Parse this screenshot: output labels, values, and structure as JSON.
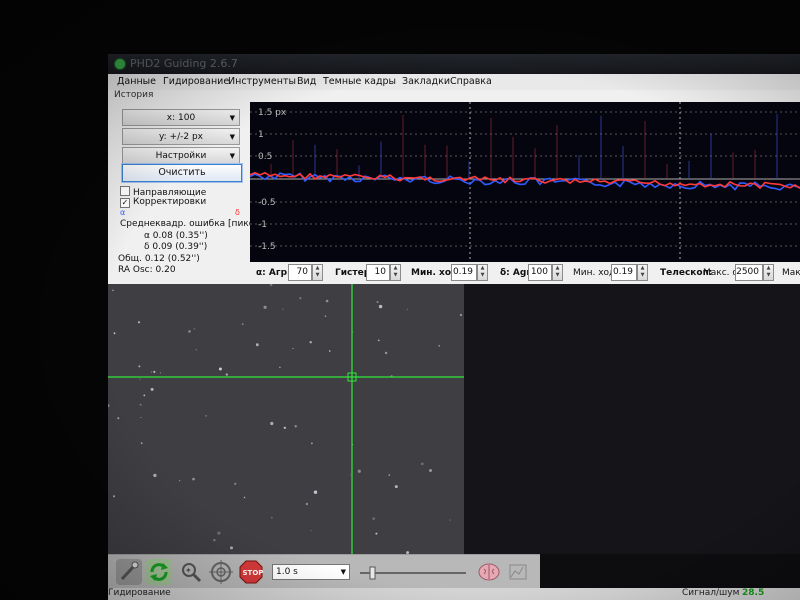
{
  "window": {
    "title": "PHD2 Guiding 2.6.7"
  },
  "menu": [
    "Данные",
    "Гидирование",
    "Инструменты",
    "Вид",
    "Темные кадры",
    "Закладки",
    "Справка"
  ],
  "history": {
    "label": "История",
    "x_scale": "x: 100",
    "y_scale": "y: +/-2 px",
    "settings": "Настройки",
    "clear": "Очистить",
    "cb_guides": "Направляющие",
    "cb_corrections": "Корректировки",
    "ra_symbol": "α",
    "dec_symbol": "δ",
    "rms_title": "Среднеквадр. ошибка [пикс.]",
    "rms_ra": "α 0.08 (0.35'')",
    "rms_dec": "δ 0.09 (0.39'')",
    "rms_total": "Общ. 0.12 (0.52'')",
    "ra_osc": "RA Osc: 0.20",
    "ytick_labels": [
      "1.5 px",
      "1",
      "0.5",
      "-0.5",
      "-1",
      "-1.5"
    ]
  },
  "params": {
    "ra_aggr_label": "α: Агр.",
    "ra_aggr": "70",
    "hyst_label": "Гистер.",
    "hyst": "10",
    "minmove_label": "Мин. ход",
    "ra_minmove": "0.19",
    "dec_aggr_label": "δ: Agr",
    "dec_aggr": "100",
    "dec_minmove_label": "Мин. ход",
    "dec_minmove": "0.19",
    "scope_label": "Телескоп:",
    "max_ra_label": "Макс. α",
    "max_ra": "2500",
    "max_dec_label": "Макс"
  },
  "toolbar": {
    "exposure": "1.0 s"
  },
  "status": {
    "mode": "Гидирование",
    "snr_label": "Сигнал/шум",
    "snr": "28.5"
  },
  "colors": {
    "ra": "#ff3a3a",
    "dec": "#2f5cff",
    "crosshair": "#2ee83a"
  }
}
